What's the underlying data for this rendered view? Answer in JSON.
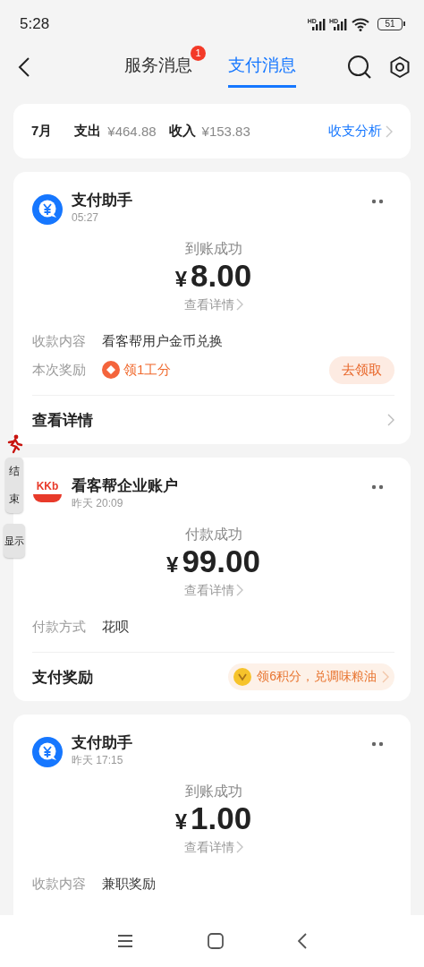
{
  "status_bar": {
    "time": "5:28",
    "signal_labels": [
      "HD",
      "HD"
    ],
    "battery": "51"
  },
  "nav": {
    "tabs": [
      {
        "label": "服务消息",
        "selected": false,
        "badge": "1"
      },
      {
        "label": "支付消息",
        "selected": true
      }
    ]
  },
  "summary": {
    "month": "7月",
    "expense_label": "支出",
    "expense": "¥464.88",
    "income_label": "收入",
    "income": "¥153.83",
    "link": "收支分析"
  },
  "messages": [
    {
      "avatar": {
        "kind": "yuan"
      },
      "sender": "支付助手",
      "time": "05:27",
      "status": "到账成功",
      "currency": "¥",
      "amount": "8.00",
      "detail_link": "查看详情",
      "fields": [
        {
          "kind": "text",
          "label": "收款内容",
          "value": "看客帮用户金币兑换"
        },
        {
          "kind": "reward",
          "label": "本次奖励",
          "value": "领1工分",
          "action": "去领取"
        }
      ],
      "footer": {
        "kind": "link",
        "label": "查看详情"
      }
    },
    {
      "avatar": {
        "kind": "logo",
        "text": "KKb"
      },
      "sender": "看客帮企业账户",
      "time": "昨天 20:09",
      "status": "付款成功",
      "currency": "¥",
      "amount": "99.00",
      "detail_link": "查看详情",
      "fields": [
        {
          "kind": "text",
          "label": "付款方式",
          "value": "花呗"
        }
      ],
      "footer": {
        "kind": "reward",
        "label": "支付奖励",
        "offer": "领6积分，兑调味粮油"
      }
    },
    {
      "avatar": {
        "kind": "yuan"
      },
      "sender": "支付助手",
      "time": "昨天 17:15",
      "status": "到账成功",
      "currency": "¥",
      "amount": "1.00",
      "detail_link": "查看详情",
      "fields": [
        {
          "kind": "text",
          "label": "收款内容",
          "value": "兼职奖励"
        }
      ]
    }
  ],
  "floating_tools": {
    "stop": "结束",
    "show": "显示"
  }
}
